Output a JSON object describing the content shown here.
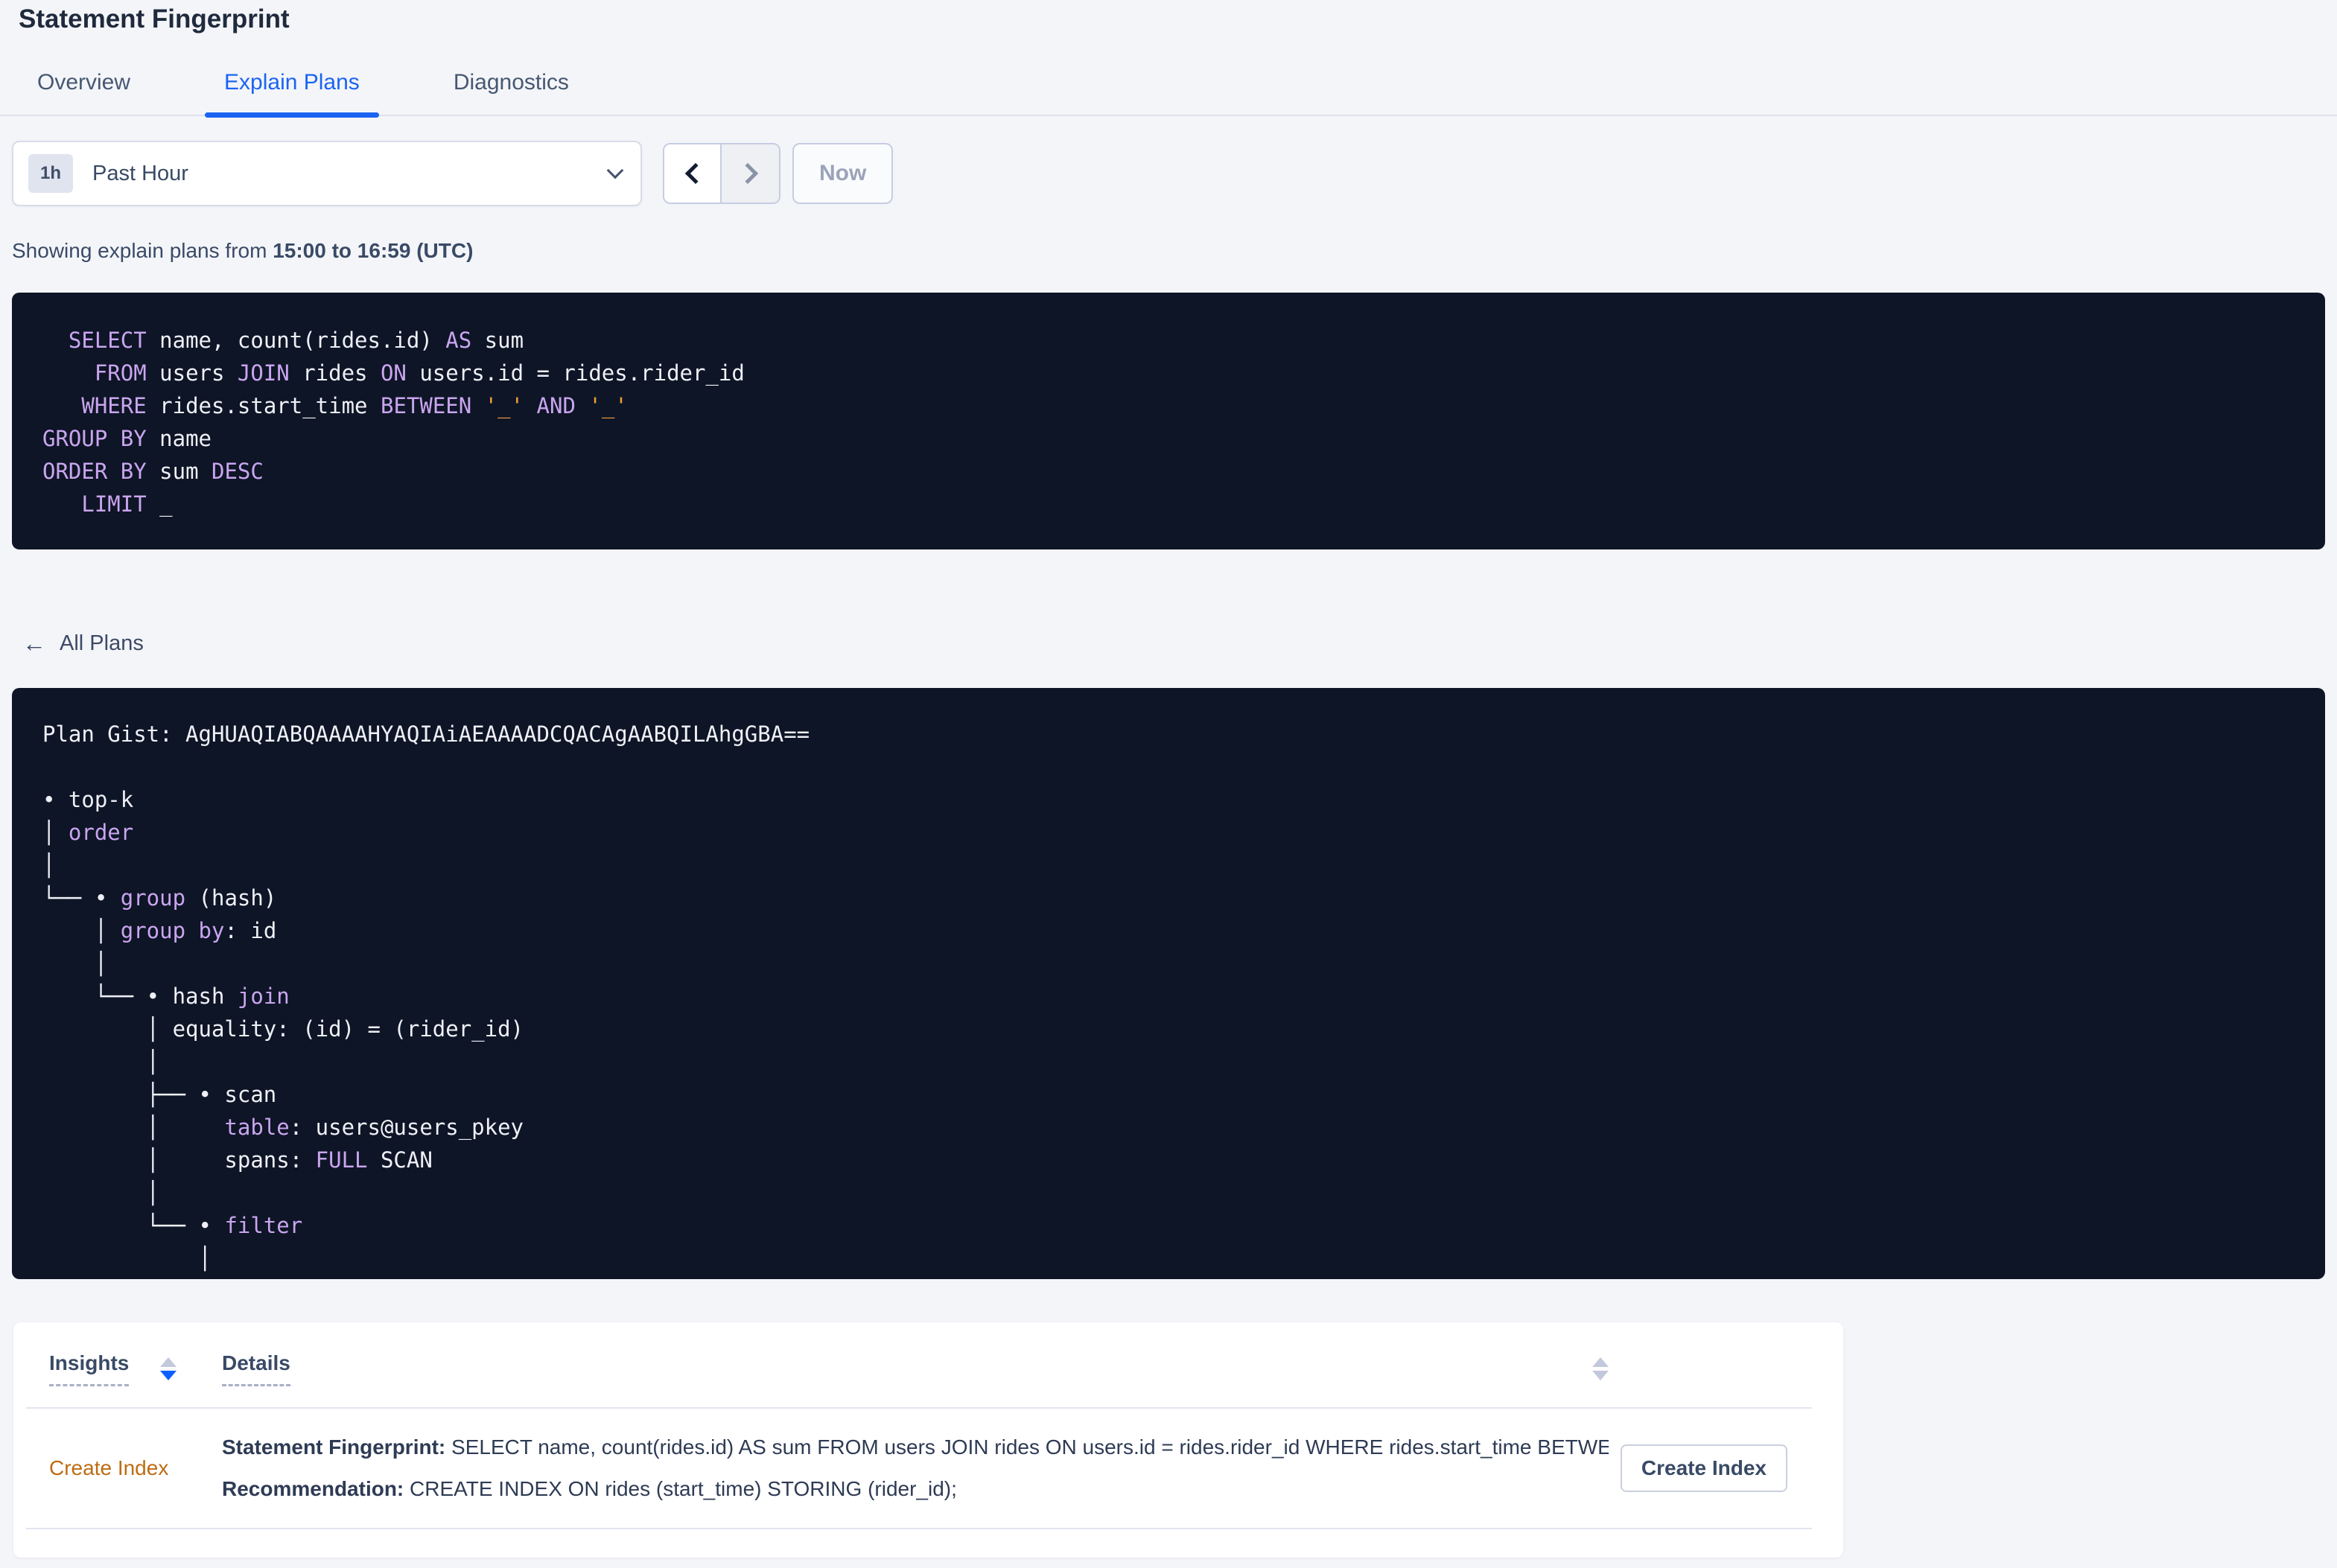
{
  "page": {
    "title": "Statement Fingerprint"
  },
  "tabs": [
    {
      "label": "Overview"
    },
    {
      "label": "Explain Plans"
    },
    {
      "label": "Diagnostics"
    }
  ],
  "time_picker": {
    "badge": "1h",
    "selected": "Past Hour",
    "now_label": "Now"
  },
  "showing": {
    "prefix": "Showing explain plans from ",
    "range": "15:00 to 16:59 (UTC)"
  },
  "icons": {
    "back_arrow": "←"
  },
  "colors": {
    "accent_blue": "#1b64f2",
    "panel_bg": "#0e1526",
    "code_text": "#eef0f6",
    "code_keyword": "#c9a5ef",
    "code_literal": "#f0a13c",
    "insight_link": "#bd6c13",
    "sort_active": "#0d60ff",
    "page_bg": "#f4f5f9"
  },
  "sql_block": {
    "lines": [
      [
        [
          "tx",
          "  "
        ],
        [
          "kw",
          "SELECT"
        ],
        [
          "tx",
          " name, count(rides.id) "
        ],
        [
          "kw",
          "AS"
        ],
        [
          "tx",
          " sum"
        ]
      ],
      [
        [
          "tx",
          "    "
        ],
        [
          "kw",
          "FROM"
        ],
        [
          "tx",
          " users "
        ],
        [
          "kw",
          "JOIN"
        ],
        [
          "tx",
          " rides "
        ],
        [
          "kw",
          "ON"
        ],
        [
          "tx",
          " users.id = rides.rider_id"
        ]
      ],
      [
        [
          "tx",
          "   "
        ],
        [
          "kw",
          "WHERE"
        ],
        [
          "tx",
          " rides.start_time "
        ],
        [
          "kw",
          "BETWEEN"
        ],
        [
          "tx",
          " "
        ],
        [
          "lit",
          "'_'"
        ],
        [
          "tx",
          " "
        ],
        [
          "kw",
          "AND"
        ],
        [
          "tx",
          " "
        ],
        [
          "lit",
          "'_'"
        ]
      ],
      [
        [
          "kw",
          "GROUP BY"
        ],
        [
          "tx",
          " name"
        ]
      ],
      [
        [
          "kw",
          "ORDER BY"
        ],
        [
          "tx",
          " sum "
        ],
        [
          "kw",
          "DESC"
        ]
      ],
      [
        [
          "tx",
          "   "
        ],
        [
          "kw",
          "LIMIT"
        ],
        [
          "tx",
          " _"
        ]
      ]
    ]
  },
  "all_plans_label": "All Plans",
  "plan_block": {
    "lines": [
      [
        [
          "tx",
          "Plan Gist: AgHUAQIABQAAAAHYAQIAiAEAAAADCQACAgAABQILAhgGBA=="
        ]
      ],
      [],
      [
        [
          "tx",
          "• top-k"
        ]
      ],
      [
        [
          "tx",
          "│ "
        ],
        [
          "kw",
          "order"
        ]
      ],
      [
        [
          "tx",
          "│"
        ]
      ],
      [
        [
          "tx",
          "└── • "
        ],
        [
          "kw",
          "group"
        ],
        [
          "tx",
          " (hash)"
        ]
      ],
      [
        [
          "tx",
          "    │ "
        ],
        [
          "kw",
          "group by"
        ],
        [
          "tx",
          ": id"
        ]
      ],
      [
        [
          "tx",
          "    │"
        ]
      ],
      [
        [
          "tx",
          "    └── • hash "
        ],
        [
          "kw",
          "join"
        ]
      ],
      [
        [
          "tx",
          "        │ equality: (id) = (rider_id)"
        ]
      ],
      [
        [
          "tx",
          "        │"
        ]
      ],
      [
        [
          "tx",
          "        ├── • scan"
        ]
      ],
      [
        [
          "tx",
          "        │     "
        ],
        [
          "kw",
          "table"
        ],
        [
          "tx",
          ": users@users_pkey"
        ]
      ],
      [
        [
          "tx",
          "        │     spans: "
        ],
        [
          "kw",
          "FULL"
        ],
        [
          "tx",
          " SCAN"
        ]
      ],
      [
        [
          "tx",
          "        │"
        ]
      ],
      [
        [
          "tx",
          "        └── • "
        ],
        [
          "kw",
          "filter"
        ]
      ],
      [
        [
          "tx",
          "            │"
        ]
      ]
    ]
  },
  "insights_table": {
    "columns": [
      "Insights",
      "Details"
    ],
    "rows": [
      {
        "insight": "Create Index",
        "fingerprint_label": "Statement Fingerprint:",
        "fingerprint_text": " SELECT name, count(rides.id) AS sum FROM users JOIN rides ON users.id = rides.rider_id WHERE rides.start_time BETWEEN '_…",
        "recommendation_label": "Recommendation:",
        "recommendation_text": " CREATE INDEX ON rides (start_time) STORING (rider_id);",
        "action": "Create Index"
      }
    ]
  }
}
